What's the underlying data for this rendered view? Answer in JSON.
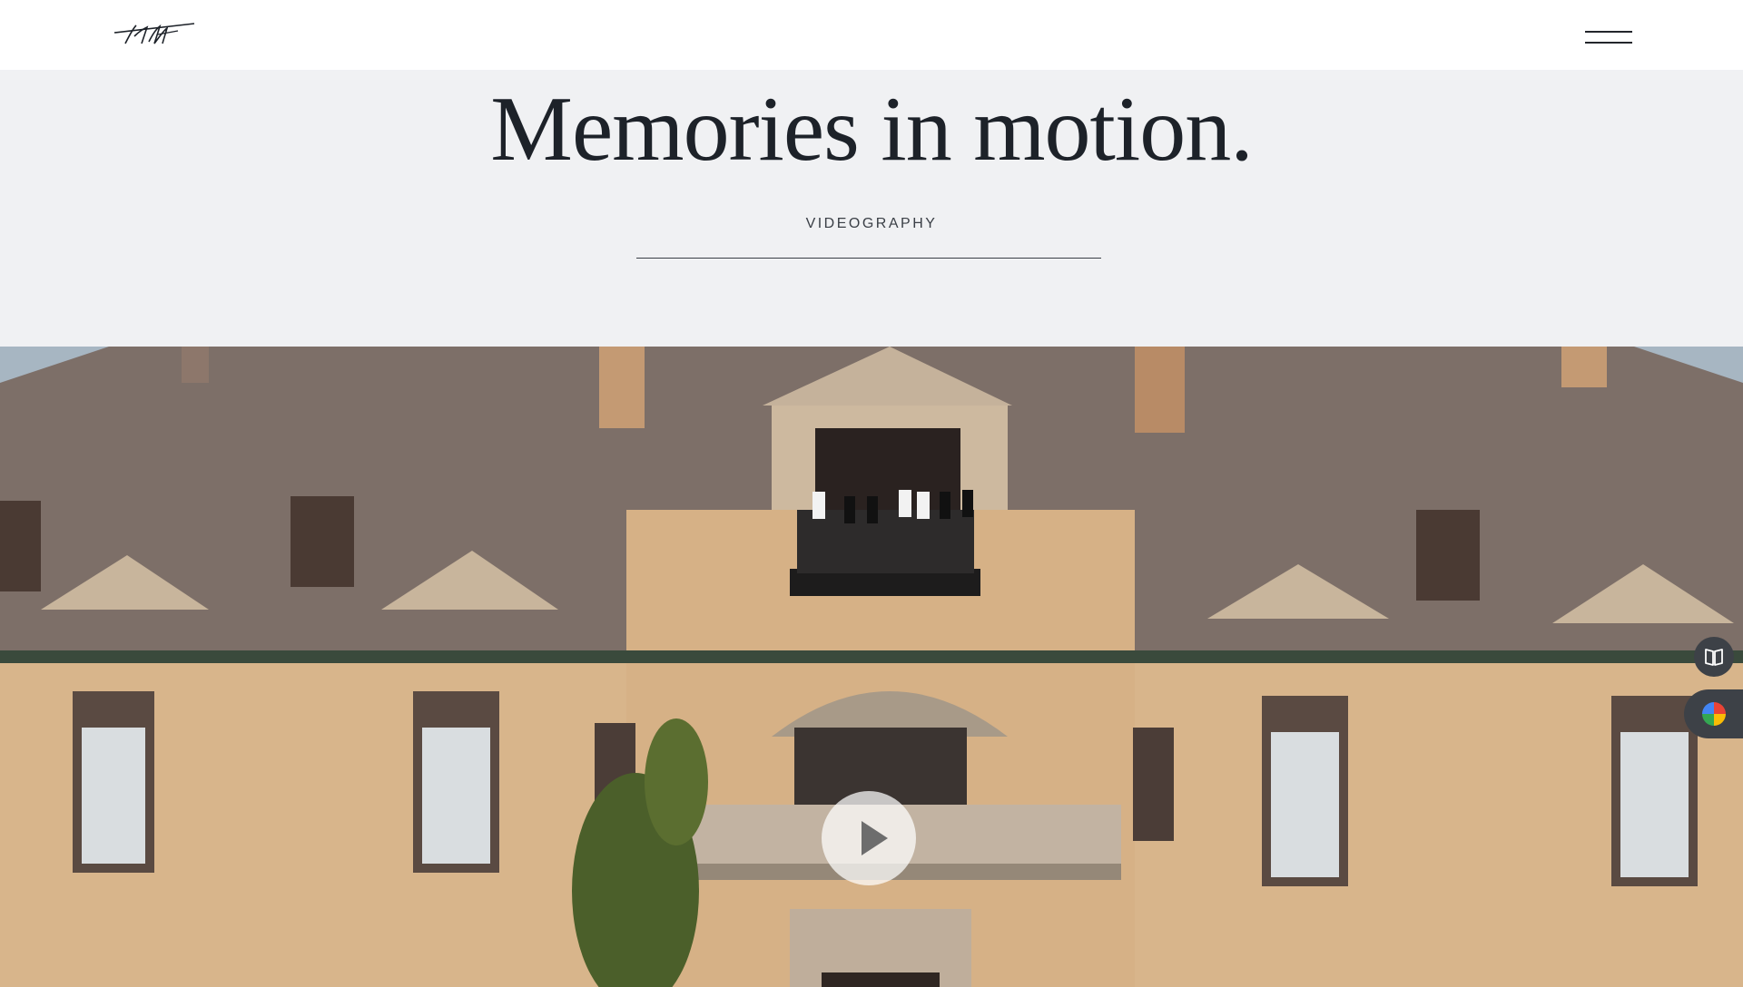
{
  "header": {
    "logo_alt": "signature logo",
    "menu_icon": "hamburger-icon"
  },
  "hero": {
    "title": "Memories in motion.",
    "subtitle": "VIDEOGRAPHY"
  },
  "video": {
    "play_icon": "play-icon"
  },
  "side_widgets": {
    "book_icon": "book-icon",
    "color_icon": "color-wheel-icon"
  },
  "colors": {
    "background": "#f0f1f3",
    "header": "#ffffff",
    "text": "#1d2229",
    "widget": "#3d4147"
  }
}
